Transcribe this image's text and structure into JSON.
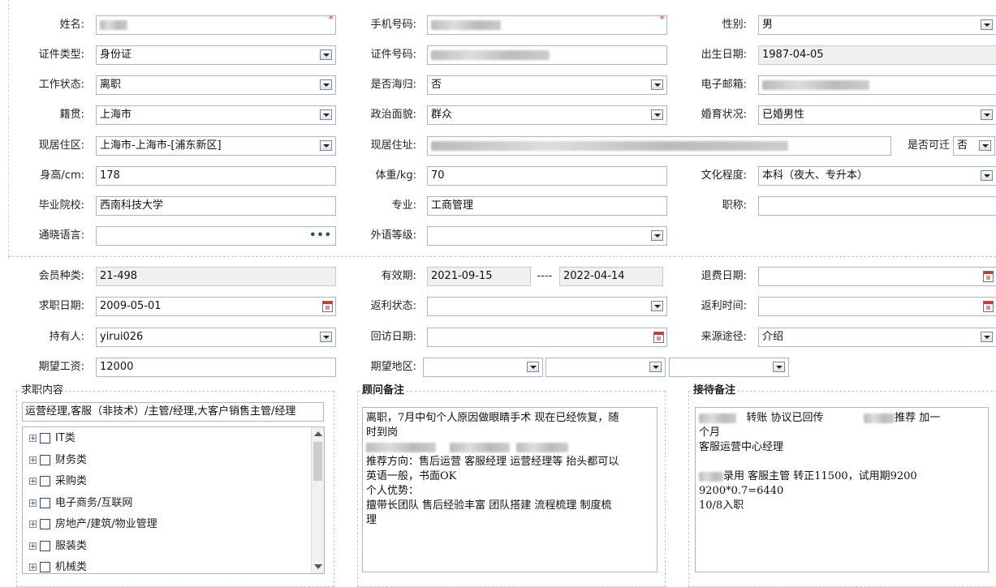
{
  "personal": {
    "name_label": "姓名:",
    "phone_label": "手机号码:",
    "gender_label": "性别:",
    "gender_value": "男",
    "id_type_label": "证件类型:",
    "id_type_value": "身份证",
    "id_no_label": "证件号码:",
    "birth_label": "出生日期:",
    "birth_value": "1987-04-05",
    "work_status_label": "工作状态:",
    "work_status_value": "离职",
    "returnee_label": "是否海归:",
    "returnee_value": "否",
    "email_label": "电子邮箱:",
    "native_label": "籍贯:",
    "native_value": "上海市",
    "political_label": "政治面貌:",
    "political_value": "群众",
    "marital_label": "婚育状况:",
    "marital_value": "已婚男性",
    "region_label": "现居住区:",
    "region_value": "上海市-上海市-[浦东新区]",
    "address_label": "现居住址:",
    "relocate_label": "是否可迁",
    "relocate_value": "否",
    "height_label": "身高/cm:",
    "height_value": "178",
    "weight_label": "体重/kg:",
    "weight_value": "70",
    "education_label": "文化程度:",
    "education_value": "本科（夜大、专升本）",
    "school_label": "毕业院校:",
    "school_value": "西南科技大学",
    "major_label": "专业:",
    "major_value": "工商管理",
    "title_label": "职称:",
    "language_label": "通晓语言:",
    "language_dots": "•••",
    "language_level_label": "外语等级:"
  },
  "membership": {
    "type_label": "会员种类:",
    "type_value": "21-498",
    "valid_label": "有效期:",
    "valid_from": "2021-09-15",
    "valid_sep": "----",
    "valid_to": "2022-04-14",
    "refund_label": "退费日期:",
    "job_date_label": "求职日期:",
    "job_date_value": "2009-05-01",
    "rebate_status_label": "返利状态:",
    "rebate_time_label": "返利时间:",
    "holder_label": "持有人:",
    "holder_value": "yirui026",
    "visit_label": "回访日期:",
    "source_label": "来源途径:",
    "source_value": "介绍",
    "salary_label": "期望工资:",
    "salary_value": "12000",
    "area_label": "期望地区:"
  },
  "job_panel": {
    "title": "求职内容",
    "selected": "运营经理,客服（非技术）/主管/经理,大客户销售主管/经理",
    "categories": [
      "IT类",
      "财务类",
      "采购类",
      "电子商务/互联网",
      "房地产/建筑/物业管理",
      "服装类",
      "机械类"
    ]
  },
  "advisor_panel": {
    "title": "顾问备注",
    "lines": [
      "离职，7月中旬个人原因做眼睛手术  现在已经恢复，随",
      "时到岗",
      "",
      "推荐方向：售后运营 客服经理  运营经理等 抬头都可以",
      "英语一般，书面OK",
      "个人优势：",
      "擅带长团队  售后经验丰富 团队搭建 流程梳理 制度梳",
      "理"
    ]
  },
  "reception_panel": {
    "title": "接待备注",
    "l1a": "转账  协议已回传",
    "l1b": "推荐  加一",
    "l2": "个月",
    "l3": "客服运营中心经理",
    "l5": "录用 客服主管 转正11500，试用期9200",
    "l6": "9200*0.7=6440",
    "l7": "10/8入职"
  }
}
